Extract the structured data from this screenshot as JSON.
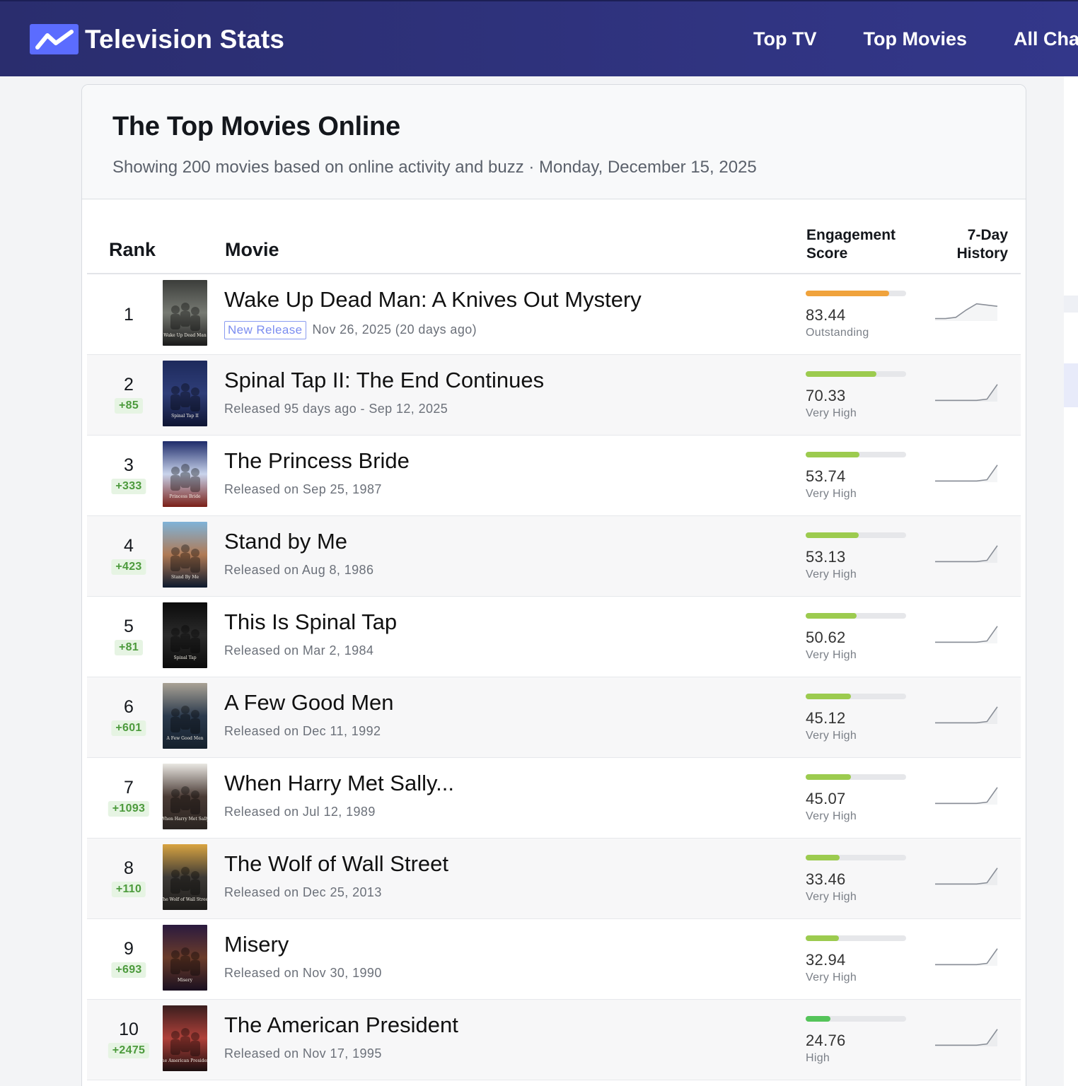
{
  "header": {
    "brand": "Television Stats",
    "nav": [
      "Top TV",
      "Top Movies",
      "All Char"
    ]
  },
  "page": {
    "title": "The Top Movies Online",
    "subtitle": "Showing 200 movies based on online activity and buzz · Monday, December 15, 2025"
  },
  "table": {
    "headers": {
      "rank": "Rank",
      "movie": "Movie",
      "score_line1": "Engagement",
      "score_line2": "Score",
      "history_line1": "7-Day",
      "history_line2": "History"
    },
    "rows": [
      {
        "rank": "1",
        "change": "",
        "title": "Wake Up Dead Man: A Knives Out Mystery",
        "badge": "New Release",
        "sub": "Nov 26, 2025 (20 days ago)",
        "score": "83.44",
        "score_num": 83.44,
        "level": "Outstanding",
        "color": "#f0a33c",
        "history": [
          2,
          2,
          3,
          9,
          14,
          13,
          12
        ],
        "poster": [
          "#3b3d3a",
          "#777a73",
          "#1a1a1a"
        ],
        "poster_text": "Wake Up Dead Man"
      },
      {
        "rank": "2",
        "change": "+85",
        "title": "Spinal Tap II: The End Continues",
        "badge": "",
        "sub": "Released 95 days ago - Sep 12, 2025",
        "score": "70.33",
        "score_num": 70.33,
        "level": "Very High",
        "color": "#9ccb4f",
        "history": [
          1,
          1,
          1,
          1,
          1,
          2,
          14
        ],
        "poster": [
          "#1d2a5c",
          "#2f3e79",
          "#0f1533"
        ],
        "poster_text": "Spinal Tap II"
      },
      {
        "rank": "3",
        "change": "+333",
        "title": "The Princess Bride",
        "badge": "",
        "sub": "Released on Sep 25, 1987",
        "score": "53.74",
        "score_num": 53.74,
        "level": "Very High",
        "color": "#9ccb4f",
        "history": [
          1,
          1,
          1,
          1,
          1,
          2,
          14
        ],
        "poster": [
          "#1e2b6a",
          "#c9d4ec",
          "#7a1f17"
        ],
        "poster_text": "Princess Bride"
      },
      {
        "rank": "4",
        "change": "+423",
        "title": "Stand by Me",
        "badge": "",
        "sub": "Released on Aug 8, 1986",
        "score": "53.13",
        "score_num": 53.13,
        "level": "Very High",
        "color": "#9ccb4f",
        "history": [
          1,
          1,
          1,
          1,
          1,
          2,
          14
        ],
        "poster": [
          "#7fb3d8",
          "#b07a55",
          "#0d1a2e"
        ],
        "poster_text": "Stand By Me"
      },
      {
        "rank": "5",
        "change": "+81",
        "title": "This Is Spinal Tap",
        "badge": "",
        "sub": "Released on Mar 2, 1984",
        "score": "50.62",
        "score_num": 50.62,
        "level": "Very High",
        "color": "#9ccb4f",
        "history": [
          1,
          1,
          1,
          1,
          1,
          2,
          14
        ],
        "poster": [
          "#0b0b0b",
          "#2b2b2b",
          "#0b0b0b"
        ],
        "poster_text": "Spinal Tap"
      },
      {
        "rank": "6",
        "change": "+601",
        "title": "A Few Good Men",
        "badge": "",
        "sub": "Released on Dec 11, 1992",
        "score": "45.12",
        "score_num": 45.12,
        "level": "Very High",
        "color": "#9ccb4f",
        "history": [
          1,
          1,
          1,
          1,
          1,
          2,
          14
        ],
        "poster": [
          "#a9a295",
          "#2b3a4d",
          "#15202c"
        ],
        "poster_text": "A Few Good Men"
      },
      {
        "rank": "7",
        "change": "+1093",
        "title": "When Harry Met Sally...",
        "badge": "",
        "sub": "Released on Jul 12, 1989",
        "score": "45.07",
        "score_num": 45.07,
        "level": "Very High",
        "color": "#9ccb4f",
        "history": [
          1,
          1,
          1,
          1,
          1,
          2,
          14
        ],
        "poster": [
          "#e9e7e2",
          "#4a3b35",
          "#2a2421"
        ],
        "poster_text": "When Harry Met Sally"
      },
      {
        "rank": "8",
        "change": "+110",
        "title": "The Wolf of Wall Street",
        "badge": "",
        "sub": "Released on Dec 25, 2013",
        "score": "33.46",
        "score_num": 33.46,
        "level": "Very High",
        "color": "#9ccb4f",
        "history": [
          1,
          1,
          1,
          1,
          1,
          2,
          14
        ],
        "poster": [
          "#d9a441",
          "#3d3a36",
          "#1f1d1b"
        ],
        "poster_text": "The Wolf of Wall Street"
      },
      {
        "rank": "9",
        "change": "+693",
        "title": "Misery",
        "badge": "",
        "sub": "Released on Nov 30, 1990",
        "score": "32.94",
        "score_num": 32.94,
        "level": "Very High",
        "color": "#9ccb4f",
        "history": [
          1,
          1,
          1,
          1,
          1,
          2,
          14
        ],
        "poster": [
          "#2a1a3f",
          "#6b3c2a",
          "#1a1020"
        ],
        "poster_text": "Misery"
      },
      {
        "rank": "10",
        "change": "+2475",
        "title": "The American President",
        "badge": "",
        "sub": "Released on Nov 17, 1995",
        "score": "24.76",
        "score_num": 24.76,
        "level": "High",
        "color": "#55c45a",
        "history": [
          1,
          1,
          1,
          1,
          1,
          2,
          14
        ],
        "poster": [
          "#3a1e1e",
          "#b0413a",
          "#1b0f10"
        ],
        "poster_text": "The American President"
      }
    ]
  }
}
